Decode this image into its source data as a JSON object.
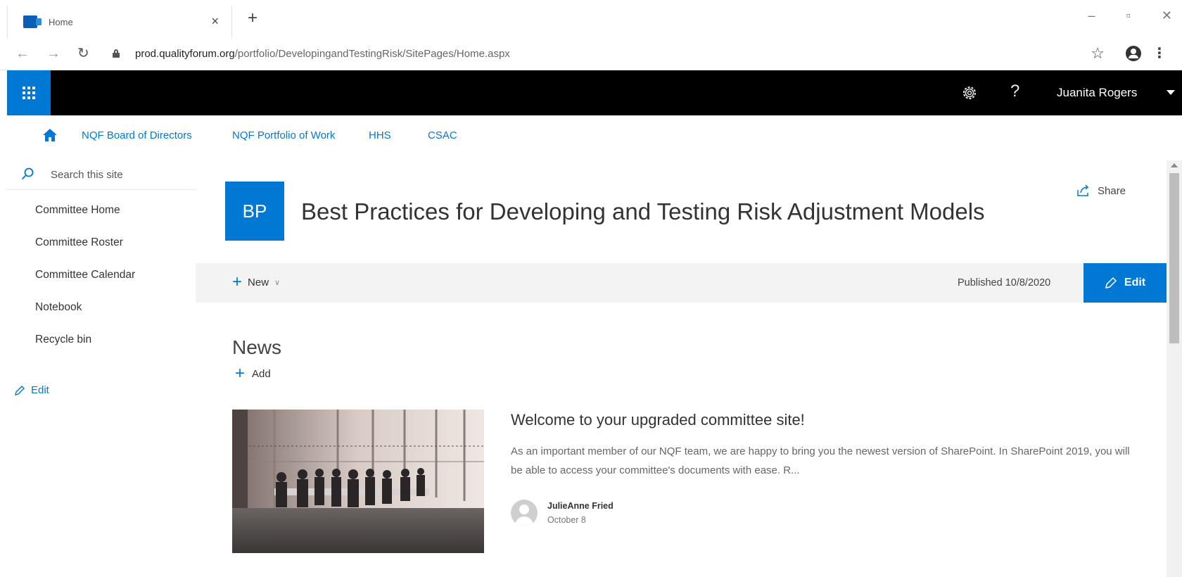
{
  "browser": {
    "tab_title": "Home",
    "tab_close": "×",
    "new_tab": "+",
    "url_host": "prod.qualityforum.org",
    "url_path": "/portfolio/DevelopingandTestingRisk/SitePages/Home.aspx",
    "window_controls": [
      "–",
      "▫",
      "✕"
    ]
  },
  "suitebar": {
    "help": "?",
    "user_name": "Juanita Rogers"
  },
  "topnav": {
    "links": [
      "NQF Board of Directors",
      "NQF Portfolio of Work",
      "HHS",
      "CSAC"
    ]
  },
  "leftnav": {
    "search_placeholder": "Search this site",
    "items": [
      "Committee Home",
      "Committee Roster",
      "Committee Calendar",
      "Notebook",
      "Recycle bin"
    ],
    "edit_label": "Edit"
  },
  "site": {
    "logo_initials": "BP",
    "title": "Best Practices for Developing and Testing Risk Adjustment Models",
    "share_label": "Share"
  },
  "commandbar": {
    "new_label": "New",
    "published": "Published 10/8/2020",
    "edit_label": "Edit"
  },
  "news": {
    "heading": "News",
    "add_label": "Add",
    "item": {
      "title": "Welcome to your upgraded committee site!",
      "description": "As an important member of our NQF team, we are happy to bring you the newest version of SharePoint. In SharePoint 2019, you will be able to access your committee's documents with ease. R...",
      "author": "JulieAnne Fried",
      "date": "October 8"
    }
  },
  "colors": {
    "accent": "#0078d4",
    "suitebar": "#000000",
    "commandbar": "#f3f3f3"
  }
}
